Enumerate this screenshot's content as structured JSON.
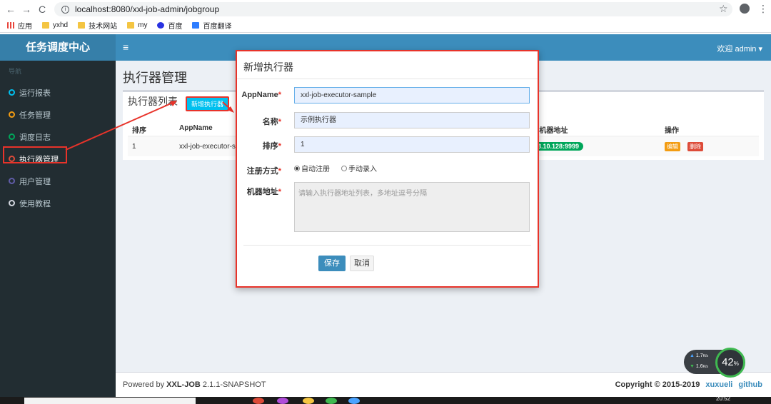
{
  "browser": {
    "url": "localhost:8080/xxl-job-admin/jobgroup",
    "bookmarks": [
      "应用",
      "yxhd",
      "技术网站",
      "my",
      "百度",
      "百度翻译"
    ]
  },
  "header": {
    "logo": "任务调度中心",
    "welcome": "欢迎 admin ▾"
  },
  "sidebar": {
    "section": "导航",
    "items": [
      {
        "label": "运行报表",
        "color": "#00c0ef"
      },
      {
        "label": "任务管理",
        "color": "#f39c12"
      },
      {
        "label": "调度日志",
        "color": "#00a65a"
      },
      {
        "label": "执行器管理",
        "color": "#dd4b39"
      },
      {
        "label": "用户管理",
        "color": "#605ca8"
      },
      {
        "label": "使用教程",
        "color": "#d2d6de"
      }
    ]
  },
  "main": {
    "page_title": "执行器管理",
    "box_title": "执行器列表",
    "add_button": "新增执行器",
    "columns": [
      "排序",
      "AppName",
      "e 机器地址",
      "操作"
    ],
    "rows": [
      {
        "order": "1",
        "appname": "xxl-job-executor-s",
        "address": "3.10.128:9999",
        "edit": "编辑",
        "delete": "删除"
      }
    ]
  },
  "modal": {
    "title": "新增执行器",
    "fields": {
      "appname_label": "AppName",
      "appname_value": "xxl-job-executor-sample",
      "title_label": "名称",
      "title_value": "示例执行器",
      "order_label": "排序",
      "order_value": "1",
      "type_label": "注册方式",
      "type_auto": "自动注册",
      "type_manual": "手动录入",
      "address_label": "机器地址",
      "address_placeholder": "请输入执行器地址列表，多地址逗号分隔"
    },
    "save": "保存",
    "cancel": "取消"
  },
  "footer": {
    "powered_prefix": "Powered by",
    "brand": "XXL-JOB",
    "version": "2.1.1-SNAPSHOT",
    "copyright": "Copyright © 2015-2019",
    "link1": "xuxueli",
    "link2": "github"
  },
  "speed": {
    "up": "1.7",
    "down": "1.6",
    "unit": "K/s",
    "percent": "42",
    "percent_sign": "%"
  },
  "taskbar": {
    "time": "20:52"
  }
}
